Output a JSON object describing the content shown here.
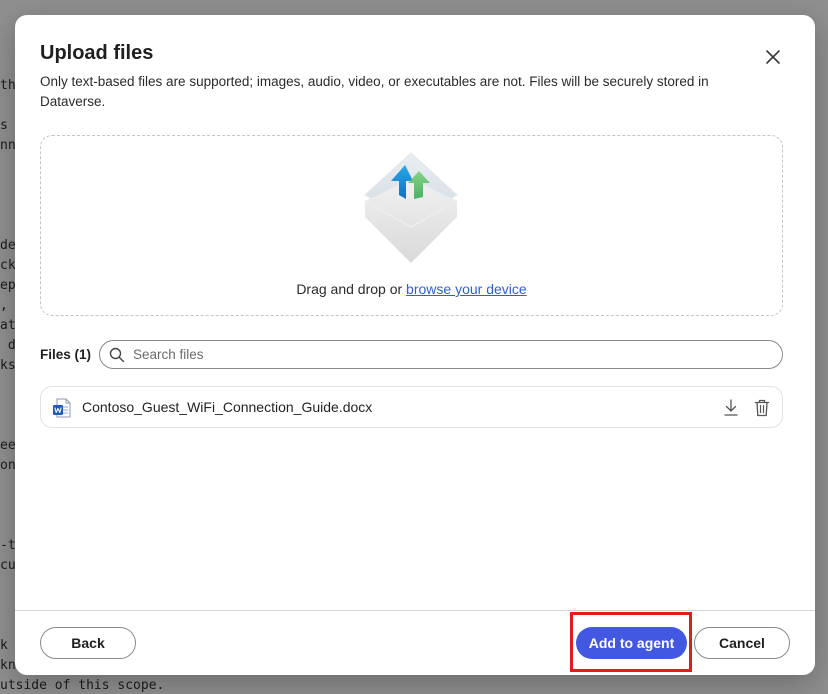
{
  "background_text": [
    "th",
    "s",
    "nn",
    "de",
    "ck",
    "ep",
    ",",
    "at",
    " d",
    "ks",
    "ee",
    "on",
    "-t",
    "cu",
    "k",
    "kn",
    "utside of this scope."
  ],
  "dialog": {
    "title": "Upload files",
    "description": "Only text-based files are supported; images, audio, video, or executables are not. Files will be securely stored in Dataverse.",
    "dropzone": {
      "prompt": "Drag and drop or ",
      "browse_link": "browse your device"
    },
    "files": {
      "label": "Files (1)",
      "search_placeholder": "Search files",
      "items": [
        {
          "name": "Contoso_Guest_WiFi_Connection_Guide.docx",
          "icon": "word-doc-icon"
        }
      ]
    },
    "footer": {
      "back_label": "Back",
      "add_label": "Add to agent",
      "cancel_label": "Cancel"
    }
  },
  "colors": {
    "accent": "#4258e0",
    "highlight": "#e31b1b",
    "link": "#2f5fd0"
  }
}
